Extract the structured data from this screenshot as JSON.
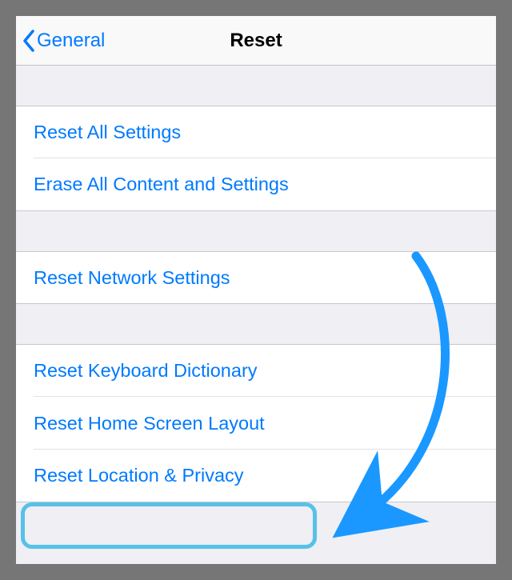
{
  "nav": {
    "back_label": "General",
    "title": "Reset"
  },
  "groups": [
    {
      "items": [
        {
          "label": "Reset All Settings"
        },
        {
          "label": "Erase All Content and Settings"
        }
      ]
    },
    {
      "items": [
        {
          "label": "Reset Network Settings"
        }
      ]
    },
    {
      "items": [
        {
          "label": "Reset Keyboard Dictionary"
        },
        {
          "label": "Reset Home Screen Layout"
        },
        {
          "label": "Reset Location & Privacy"
        }
      ]
    }
  ],
  "colors": {
    "link": "#007aff",
    "highlight": "#57c1e8",
    "arrow": "#1a98ff"
  }
}
